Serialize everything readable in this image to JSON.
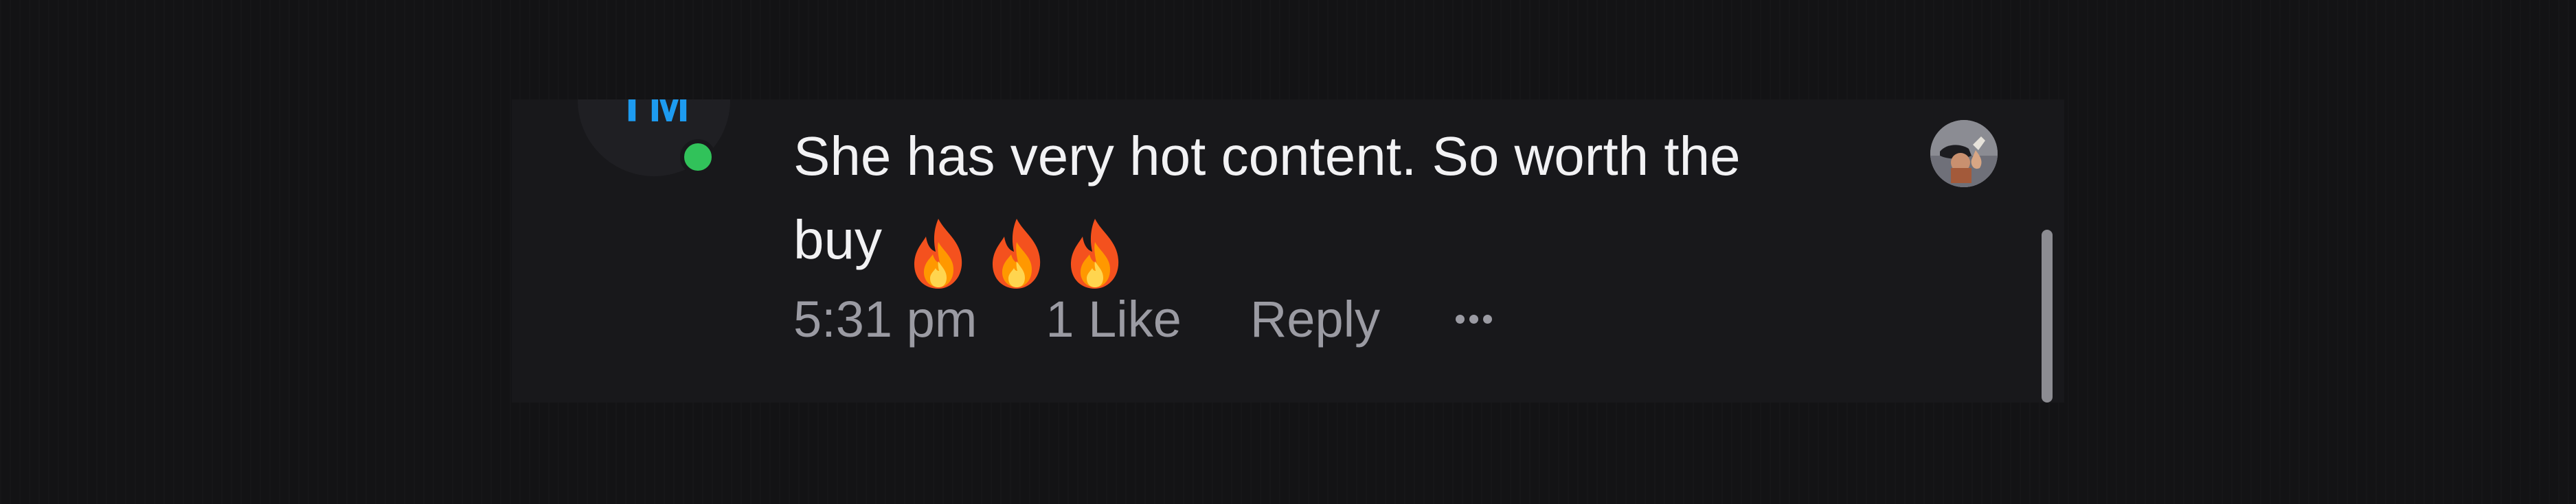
{
  "comment": {
    "author_initials": "TM",
    "online": true,
    "text_main": "She has very hot content. So worth the buy",
    "emojis": [
      "fire-emoji",
      "fire-emoji",
      "fire-emoji"
    ],
    "time": "5:31 pm",
    "likes": "1 Like",
    "reply_label": "Reply",
    "more_icon": "ellipsis-icon",
    "reactor_avatar_icon": "user-photo-avatar"
  },
  "colors": {
    "background": "#131315",
    "card": "#18181b",
    "text": "#f2f2f4",
    "meta_text": "#9b9ba3",
    "initials": "#1d9bf0",
    "online_dot": "#31c25a",
    "scrollbar": "#8c8c92"
  }
}
